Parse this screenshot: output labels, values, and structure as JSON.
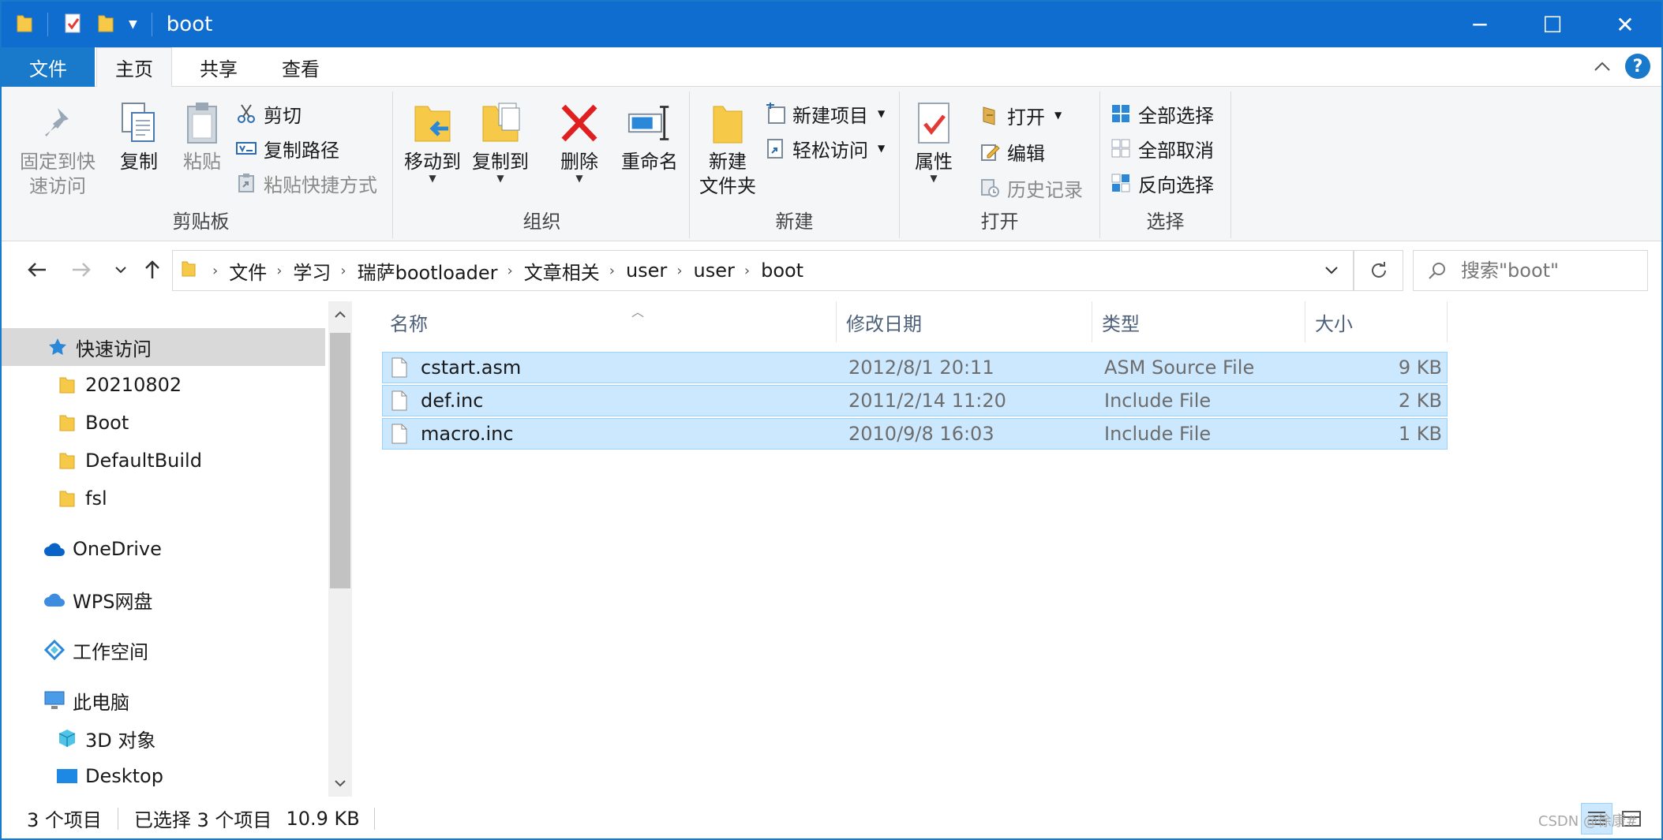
{
  "window": {
    "title": "boot",
    "controls": {
      "minimize": "─",
      "maximize": "☐",
      "close": "✕"
    }
  },
  "tabs": [
    {
      "label": "文件"
    },
    {
      "label": "主页"
    },
    {
      "label": "共享"
    },
    {
      "label": "查看"
    }
  ],
  "help": "?",
  "ribbon": {
    "clipboard": {
      "label": "剪贴板",
      "pin_line1": "固定到快",
      "pin_line2": "速访问",
      "copy": "复制",
      "paste": "粘贴",
      "cut": "剪切",
      "copy_path": "复制路径",
      "paste_shortcut": "粘贴快捷方式"
    },
    "organize": {
      "label": "组织",
      "move_to": "移动到",
      "copy_to": "复制到",
      "delete": "删除",
      "rename": "重命名"
    },
    "new": {
      "label": "新建",
      "new_folder_line1": "新建",
      "new_folder_line2": "文件夹",
      "new_item": "新建项目",
      "easy_access": "轻松访问"
    },
    "open": {
      "label": "打开",
      "properties": "属性",
      "open": "打开",
      "edit": "编辑",
      "history": "历史记录"
    },
    "select": {
      "label": "选择",
      "select_all": "全部选择",
      "select_none": "全部取消",
      "invert": "反向选择"
    }
  },
  "address": {
    "crumbs": [
      "文件",
      "学习",
      "瑞萨bootloader",
      "文章相关",
      "user",
      "user",
      "boot"
    ],
    "search_placeholder": "搜索\"boot\""
  },
  "nav": {
    "quick_access": "快速访问",
    "quick_items": [
      "20210802",
      "Boot",
      "DefaultBuild",
      "fsl"
    ],
    "onedrive": "OneDrive",
    "wps": "WPS网盘",
    "workspace": "工作空间",
    "this_pc": "此电脑",
    "pc_items": [
      "3D 对象",
      "Desktop"
    ]
  },
  "columns": {
    "name": "名称",
    "date": "修改日期",
    "type": "类型",
    "size": "大小"
  },
  "files": [
    {
      "name": "cstart.asm",
      "date": "2012/8/1 20:11",
      "type": "ASM Source File",
      "size": "9 KB"
    },
    {
      "name": "def.inc",
      "date": "2011/2/14 11:20",
      "type": "Include File",
      "size": "2 KB"
    },
    {
      "name": "macro.inc",
      "date": "2010/9/8 16:03",
      "type": "Include File",
      "size": "1 KB"
    }
  ],
  "status": {
    "count": "3 个项目",
    "selected": "已选择 3 个项目",
    "size": "10.9 KB"
  },
  "watermark": "CSDN @徐康#",
  "colors": {
    "accent": "#1979ca",
    "titlebar": "#0f6dd0",
    "selection": "#cce8ff",
    "selection_border": "#99d1ff",
    "folder": "#f7c948"
  }
}
